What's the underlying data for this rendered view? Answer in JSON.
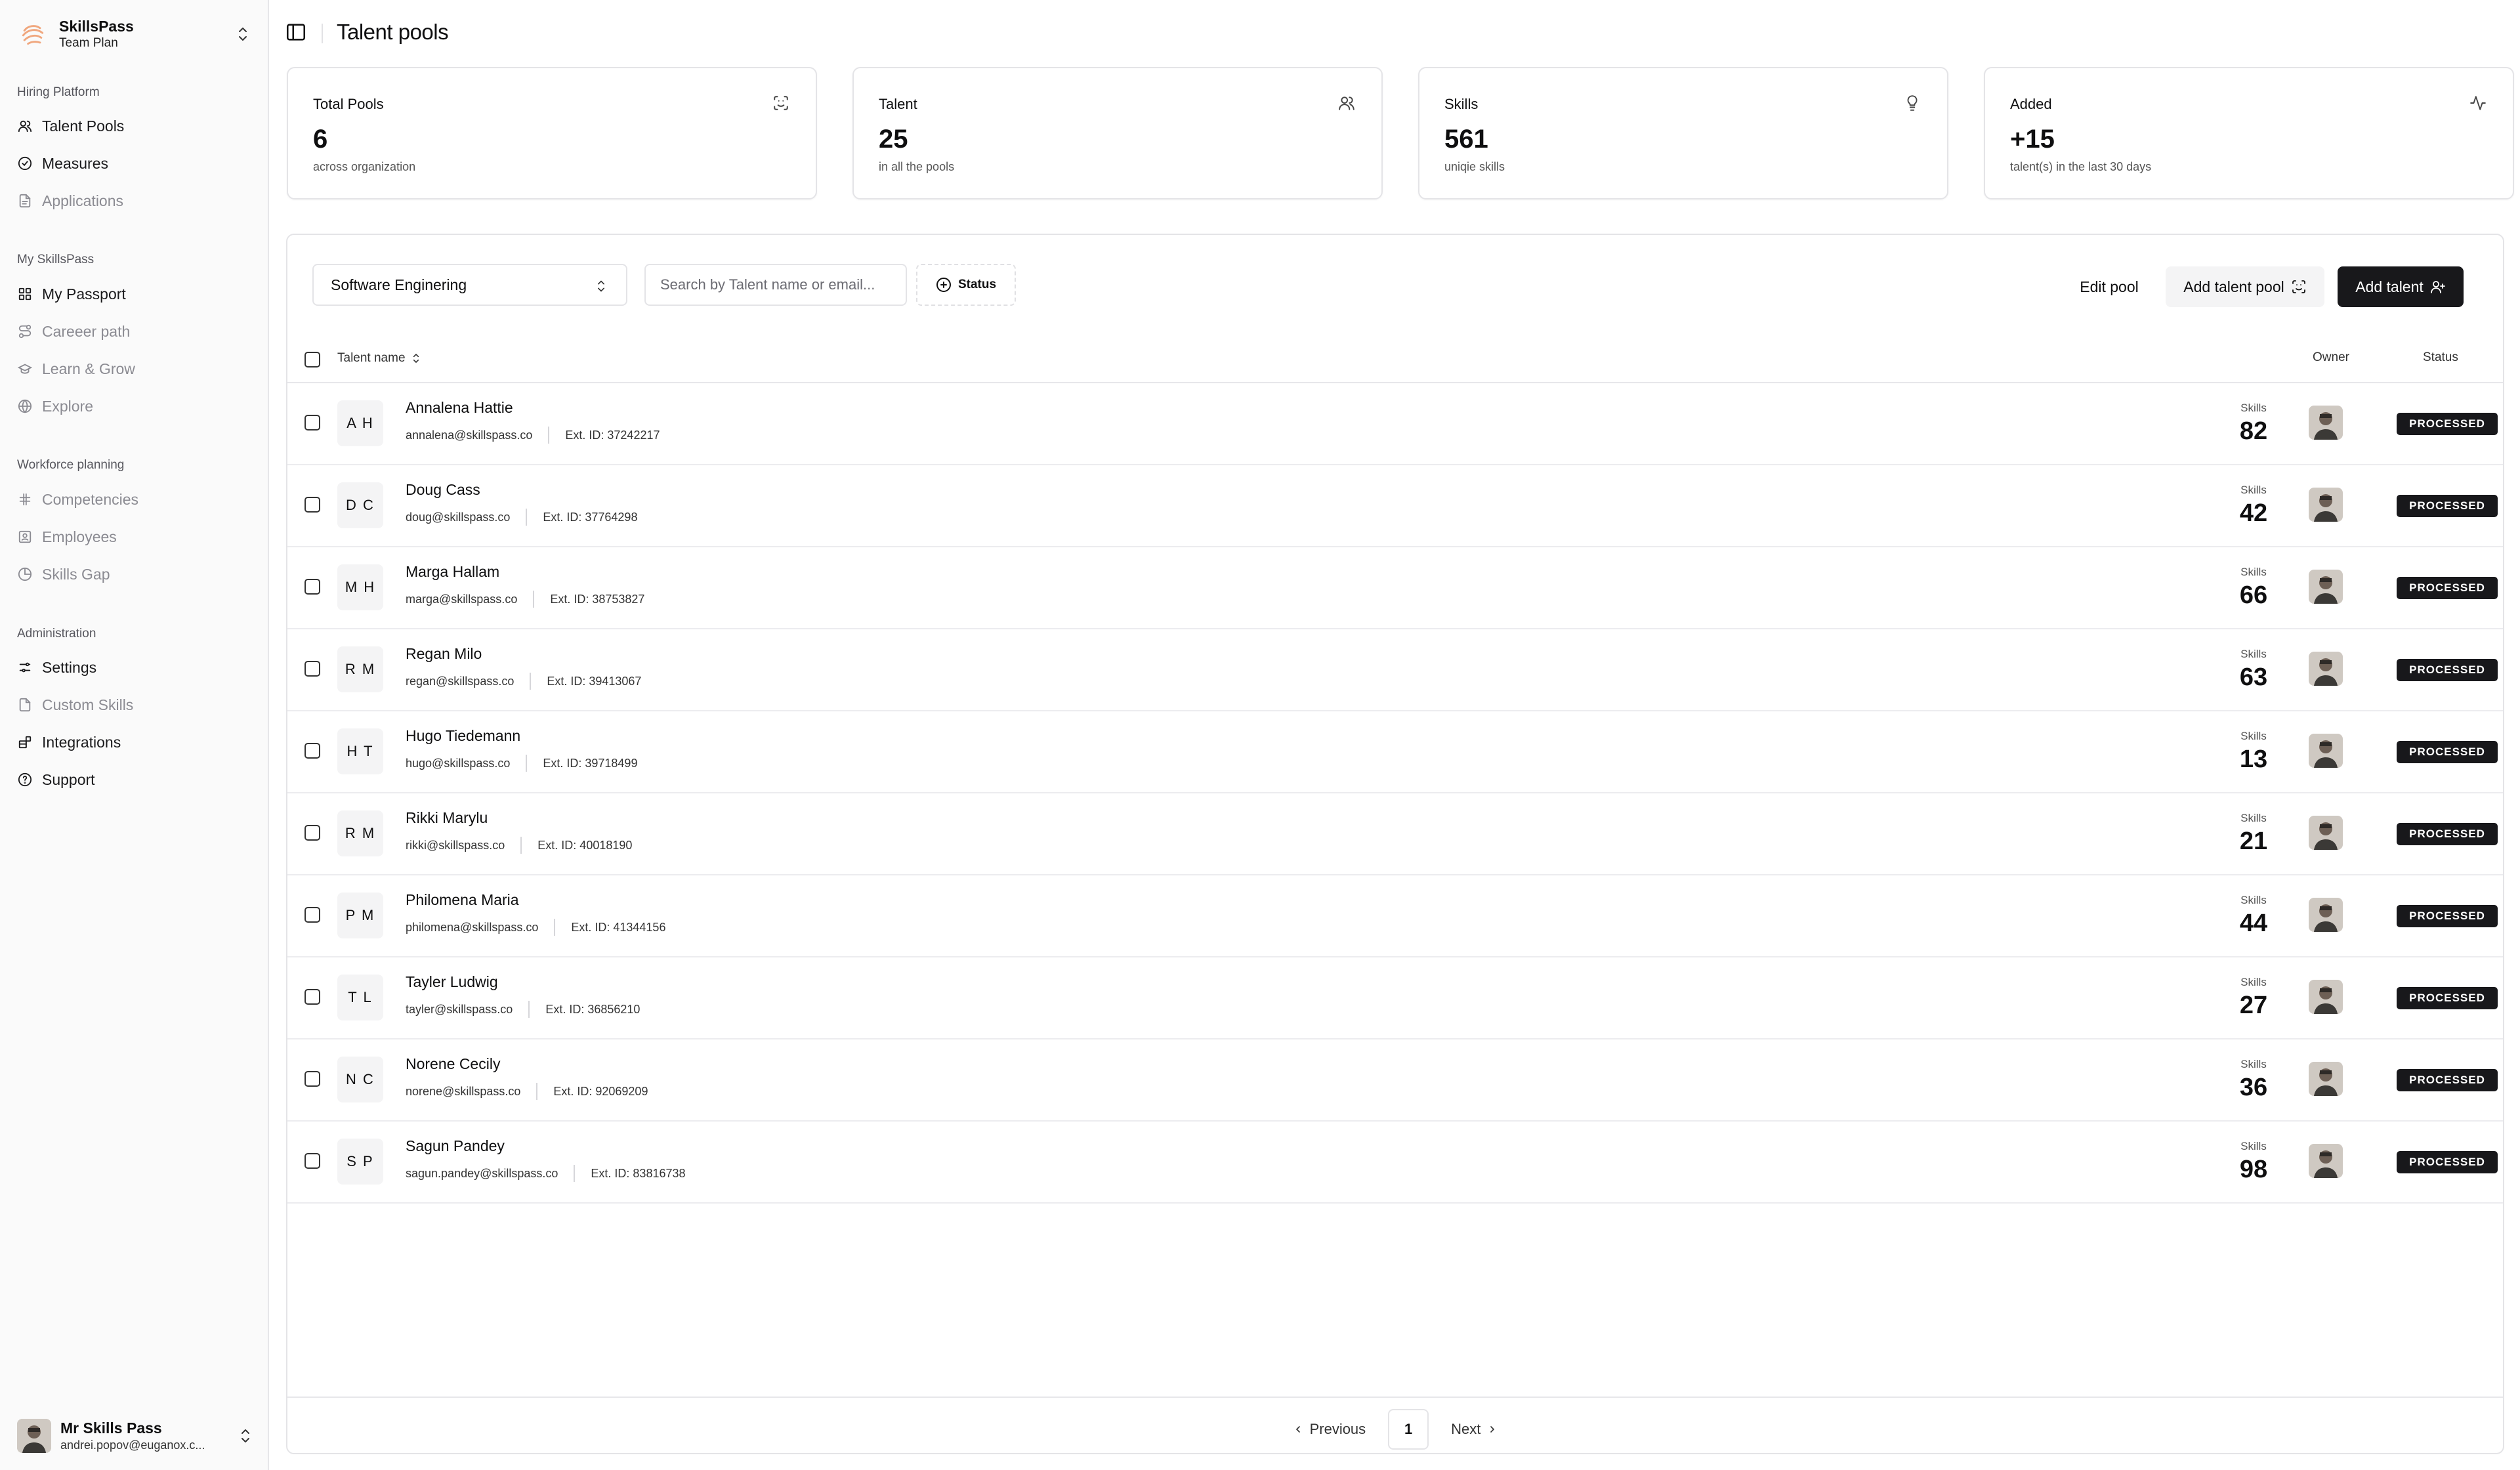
{
  "brand": {
    "name": "SkillsPass",
    "plan": "Team Plan"
  },
  "sidebar": {
    "sections": [
      {
        "label": "Hiring Platform",
        "items": [
          {
            "label": "Talent Pools",
            "icon": "users-icon",
            "active": true
          },
          {
            "label": "Measures",
            "icon": "circle-check-icon",
            "active": true
          },
          {
            "label": "Applications",
            "icon": "file-icon",
            "active": false
          }
        ]
      },
      {
        "label": "My SkillsPass",
        "items": [
          {
            "label": "My Passport",
            "icon": "grid-icon",
            "active": true
          },
          {
            "label": "Careeer path",
            "icon": "route-icon",
            "active": false
          },
          {
            "label": "Learn & Grow",
            "icon": "graduation-cap-icon",
            "active": false
          },
          {
            "label": "Explore",
            "icon": "globe-icon",
            "active": false
          }
        ]
      },
      {
        "label": "Workforce planning",
        "items": [
          {
            "label": "Competencies",
            "icon": "hash-icon",
            "active": false
          },
          {
            "label": "Employees",
            "icon": "id-card-icon",
            "active": false
          },
          {
            "label": "Skills Gap",
            "icon": "pie-chart-icon",
            "active": false
          }
        ]
      },
      {
        "label": "Administration",
        "items": [
          {
            "label": "Settings",
            "icon": "sliders-icon",
            "active": true
          },
          {
            "label": "Custom Skills",
            "icon": "file-icon",
            "active": false
          },
          {
            "label": "Integrations",
            "icon": "blocks-icon",
            "active": true
          },
          {
            "label": "Support",
            "icon": "help-circle-icon",
            "active": true
          }
        ]
      }
    ],
    "user": {
      "name": "Mr Skills Pass",
      "email": "andrei.popov@euganox.c..."
    }
  },
  "header": {
    "title": "Talent pools"
  },
  "stats": [
    {
      "title": "Total Pools",
      "value": "6",
      "sub": "across organization",
      "icon": "scan-face-icon"
    },
    {
      "title": "Talent",
      "value": "25",
      "sub": "in all the pools",
      "icon": "users-icon"
    },
    {
      "title": "Skills",
      "value": "561",
      "sub": "uniqie skills",
      "icon": "lightbulb-icon"
    },
    {
      "title": "Added",
      "value": "+15",
      "sub": "talent(s) in the last 30 days",
      "icon": "activity-icon"
    }
  ],
  "toolbar": {
    "pool_selected": "Software Enginering",
    "search_placeholder": "Search by Talent name or email...",
    "status_filter": "Status",
    "edit_pool": "Edit pool",
    "add_pool": "Add talent pool",
    "add_talent": "Add talent"
  },
  "table": {
    "headers": {
      "name": "Talent name",
      "owner": "Owner",
      "status": "Status"
    },
    "skills_label": "Skills",
    "rows": [
      {
        "initials": "A H",
        "name": "Annalena Hattie",
        "email": "annalena@skillspass.co",
        "ext": "Ext. ID: 37242217",
        "skills": "82",
        "status": "PROCESSED"
      },
      {
        "initials": "D C",
        "name": "Doug Cass",
        "email": "doug@skillspass.co",
        "ext": "Ext. ID: 37764298",
        "skills": "42",
        "status": "PROCESSED"
      },
      {
        "initials": "M H",
        "name": "Marga Hallam",
        "email": "marga@skillspass.co",
        "ext": "Ext. ID: 38753827",
        "skills": "66",
        "status": "PROCESSED"
      },
      {
        "initials": "R M",
        "name": "Regan Milo",
        "email": "regan@skillspass.co",
        "ext": "Ext. ID: 39413067",
        "skills": "63",
        "status": "PROCESSED"
      },
      {
        "initials": "H T",
        "name": "Hugo Tiedemann",
        "email": "hugo@skillspass.co",
        "ext": "Ext. ID: 39718499",
        "skills": "13",
        "status": "PROCESSED"
      },
      {
        "initials": "R M",
        "name": "Rikki Marylu",
        "email": "rikki@skillspass.co",
        "ext": "Ext. ID: 40018190",
        "skills": "21",
        "status": "PROCESSED"
      },
      {
        "initials": "P M",
        "name": "Philomena Maria",
        "email": "philomena@skillspass.co",
        "ext": "Ext. ID: 41344156",
        "skills": "44",
        "status": "PROCESSED"
      },
      {
        "initials": "T L",
        "name": "Tayler Ludwig",
        "email": "tayler@skillspass.co",
        "ext": "Ext. ID: 36856210",
        "skills": "27",
        "status": "PROCESSED"
      },
      {
        "initials": "N C",
        "name": "Norene Cecily",
        "email": "norene@skillspass.co",
        "ext": "Ext. ID: 92069209",
        "skills": "36",
        "status": "PROCESSED"
      },
      {
        "initials": "S P",
        "name": "Sagun Pandey",
        "email": "sagun.pandey@skillspass.co",
        "ext": "Ext. ID: 83816738",
        "skills": "98",
        "status": "PROCESSED"
      }
    ]
  },
  "pagination": {
    "previous": "Previous",
    "page": "1",
    "next": "Next"
  },
  "colors": {
    "accent": "#18181b",
    "brand_logo": "#f0a77e",
    "border": "#e4e4e7",
    "muted_text": "#8b8b92"
  }
}
